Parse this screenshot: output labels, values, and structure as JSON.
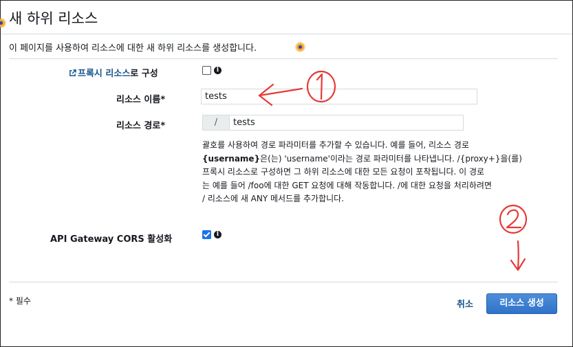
{
  "page": {
    "title": "새 하위 리소스",
    "description": "이 페이지를 사용하여 리소스에 대한 새 하위 리소스를 생성합니다."
  },
  "form": {
    "proxy": {
      "link_text": "프록시 리소스",
      "label_suffix": "로 구성",
      "checked": false
    },
    "resource_name": {
      "label": "리소스 이름*",
      "value": "tests"
    },
    "resource_path": {
      "label": "리소스 경로*",
      "prefix": "/",
      "value": "tests"
    },
    "help": {
      "line1": "괄호를 사용하여 경로 파라미터를 추가할 수 있습니다. 예를 들어, 리소스 경로",
      "line2_bold": "{username}",
      "line2_rest": "은(는) 'username'이라는 경로 파라미터를 나타냅니다. /{proxy+}을(를)",
      "line3": "프록시 리소스로 구성하면 그 하위 리소스에 대한 모든 요청이 포착됩니다. 이 경로",
      "line4": "는 예를 들어 /foo에 대한 GET 요청에 대해 작동합니다. /에 대한 요청을 처리하려면",
      "line5": "/ 리소스에 새 ANY 메서드를 추가합니다."
    },
    "cors": {
      "label": "API Gateway CORS 활성화",
      "checked": true
    }
  },
  "footer": {
    "required_note": "* 필수",
    "cancel_label": "취소",
    "create_label": "리소스 생성"
  },
  "colors": {
    "link": "#16538c",
    "primary_button": "#2f73c9",
    "annotation": "#e53935",
    "help_dot": "#f8a63a"
  }
}
